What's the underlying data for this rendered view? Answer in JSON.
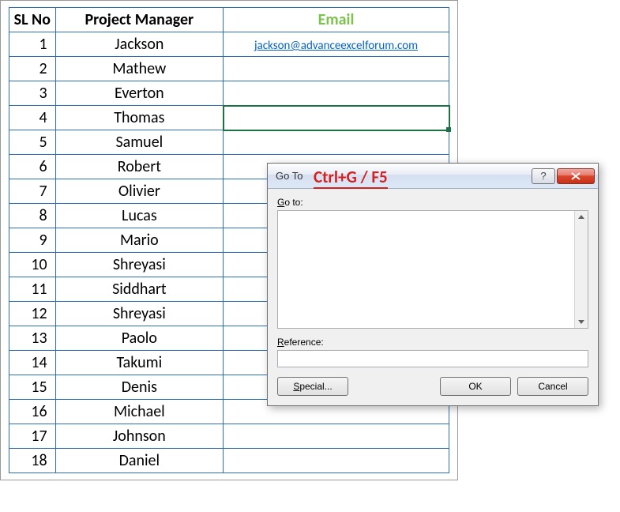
{
  "headers": {
    "sl": "SL No",
    "pm": "Project Manager",
    "email": "Email"
  },
  "rows": [
    {
      "sl": "1",
      "pm": "Jackson",
      "email": "jackson@advanceexcelforum.com"
    },
    {
      "sl": "2",
      "pm": "Mathew",
      "email": ""
    },
    {
      "sl": "3",
      "pm": "Everton",
      "email": ""
    },
    {
      "sl": "4",
      "pm": "Thomas",
      "email": "",
      "selected": true
    },
    {
      "sl": "5",
      "pm": "Samuel",
      "email": ""
    },
    {
      "sl": "6",
      "pm": "Robert",
      "email": ""
    },
    {
      "sl": "7",
      "pm": "Olivier",
      "email": ""
    },
    {
      "sl": "8",
      "pm": "Lucas",
      "email": ""
    },
    {
      "sl": "9",
      "pm": "Mario",
      "email": ""
    },
    {
      "sl": "10",
      "pm": "Shreyasi",
      "email": ""
    },
    {
      "sl": "11",
      "pm": "Siddhart",
      "email": ""
    },
    {
      "sl": "12",
      "pm": "Shreyasi",
      "email": ""
    },
    {
      "sl": "13",
      "pm": "Paolo",
      "email": ""
    },
    {
      "sl": "14",
      "pm": "Takumi",
      "email": ""
    },
    {
      "sl": "15",
      "pm": "Denis",
      "email": ""
    },
    {
      "sl": "16",
      "pm": "Michael",
      "email": ""
    },
    {
      "sl": "17",
      "pm": "Johnson",
      "email": ""
    },
    {
      "sl": "18",
      "pm": "Daniel",
      "email": ""
    }
  ],
  "dialog": {
    "title": "Go To",
    "annotation": "Ctrl+G / F5",
    "goto_label": "Go to:",
    "reference_label": "Reference:",
    "reference_value": "",
    "special_label": "Special...",
    "ok_label": "OK",
    "cancel_label": "Cancel"
  }
}
